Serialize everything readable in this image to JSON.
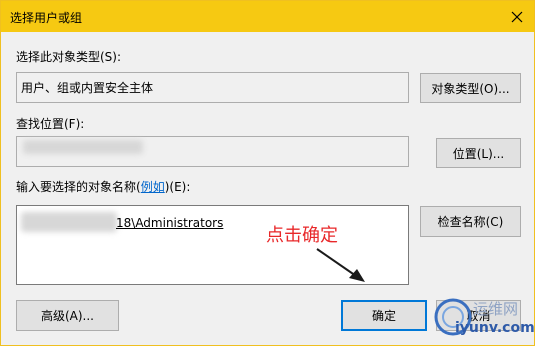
{
  "window": {
    "title": "选择用户或组"
  },
  "object_type": {
    "label": "选择此对象类型(S):",
    "value": "用户、组或内置安全主体",
    "button": "对象类型(O)..."
  },
  "location": {
    "label": "查找位置(F):",
    "button": "位置(L)..."
  },
  "names": {
    "label_prefix": "输入要选择的对象名称(",
    "label_link": "例如",
    "label_suffix": ")(E):",
    "value_visible": "18\\Administrators",
    "check_button": "检查名称(C)"
  },
  "buttons": {
    "advanced": "高级(A)...",
    "ok": "确定",
    "cancel": "取消"
  },
  "annotation": {
    "text": "点击确定"
  },
  "watermark": {
    "line1": "运维网",
    "line2": "iyunv.com"
  },
  "colors": {
    "titlebar": "#f6c912",
    "annotation": "#e8282a",
    "default_button_border": "#0078d7"
  }
}
